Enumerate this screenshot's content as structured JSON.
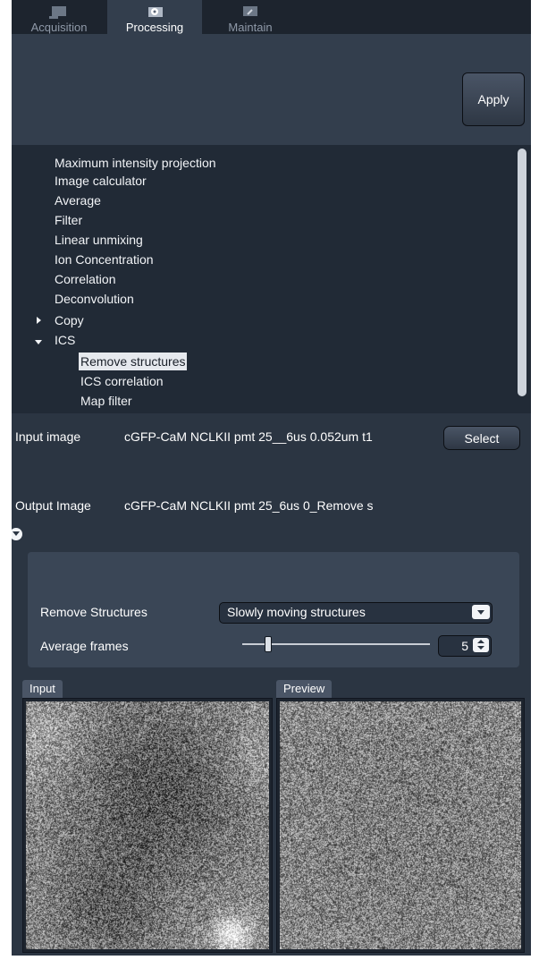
{
  "tabs": [
    {
      "label": "Acquisition",
      "icon": "acquisition-icon",
      "active": false
    },
    {
      "label": "Processing",
      "icon": "gear-icon",
      "active": true
    },
    {
      "label": "Maintain",
      "icon": "wrench-icon",
      "active": false
    }
  ],
  "toolbar": {
    "apply_label": "Apply"
  },
  "method_tree": {
    "items": [
      {
        "label": "Maximum intensity projection",
        "level": 1
      },
      {
        "label": "Image calculator",
        "level": 1
      },
      {
        "label": "Average",
        "level": 1
      },
      {
        "label": "Filter",
        "level": 1
      },
      {
        "label": "Linear unmixing",
        "level": 1
      },
      {
        "label": "Ion Concentration",
        "level": 1
      },
      {
        "label": "Correlation",
        "level": 1
      },
      {
        "label": "Deconvolution",
        "level": 1
      },
      {
        "label": "Copy",
        "level": 1,
        "expanded": false
      },
      {
        "label": "ICS",
        "level": 1,
        "expanded": true
      },
      {
        "label": "Remove structures",
        "level": 2,
        "selected": true
      },
      {
        "label": "ICS correlation",
        "level": 2
      },
      {
        "label": "Map filter",
        "level": 2
      }
    ]
  },
  "input": {
    "label": "Input image",
    "value": "cGFP-CaM NCLKII pmt 25__6us 0.052um t1",
    "select_label": "Select"
  },
  "output": {
    "label": "Output Image",
    "value": "cGFP-CaM NCLKII pmt 25_6us 0_Remove s"
  },
  "params": {
    "remove_structures": {
      "label": "Remove Structures",
      "value": "Slowly moving structures"
    },
    "average_frames": {
      "label": "Average frames",
      "value": 5,
      "slider_fraction": 0.14
    }
  },
  "views": {
    "input_label": "Input",
    "preview_label": "Preview"
  },
  "colors": {
    "panel": "#2b3542",
    "tabbar": "#1d242e",
    "tree_bg": "#212a36",
    "selected_bg": "#e6e9ee"
  }
}
